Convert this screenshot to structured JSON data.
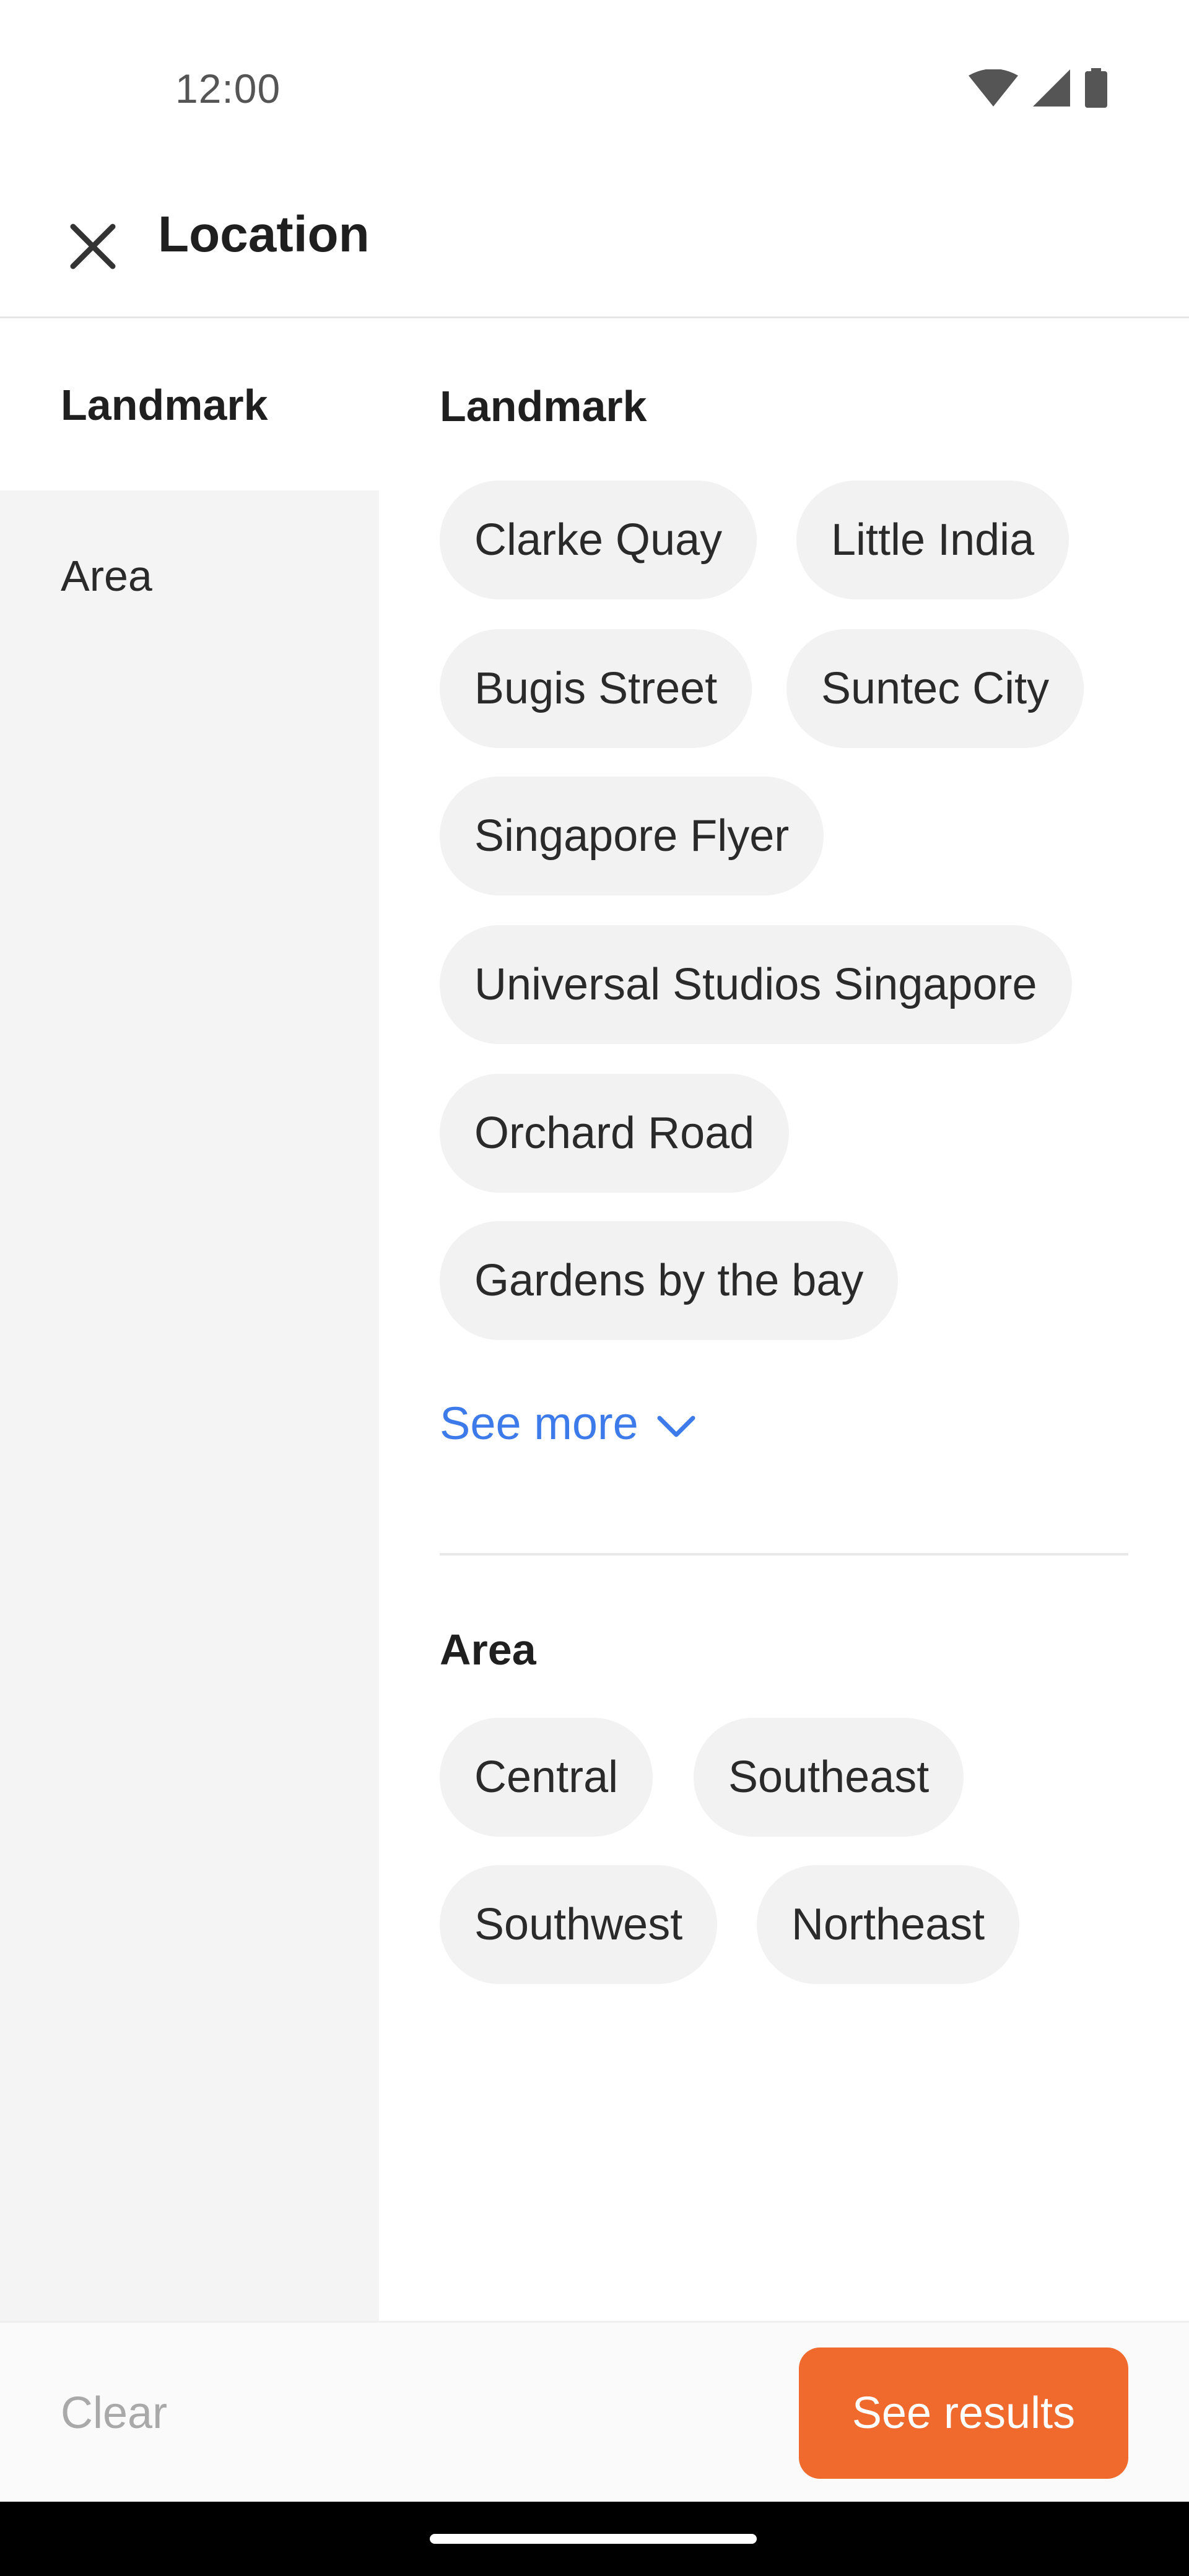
{
  "status_bar": {
    "time": "12:00",
    "icons": [
      "wifi-icon",
      "cellular-signal-icon",
      "battery-icon"
    ]
  },
  "header": {
    "close_icon": "close-icon",
    "title": "Location"
  },
  "left_nav": {
    "items": [
      {
        "label": "Landmark",
        "active": true
      },
      {
        "label": "Area",
        "active": false
      }
    ]
  },
  "landmark_section": {
    "title": "Landmark",
    "chips": [
      "Clarke Quay",
      "Little India",
      "Bugis Street",
      "Suntec City",
      "Singapore Flyer",
      "Universal Studios Singapore",
      "Orchard Road",
      "Gardens by the bay"
    ],
    "see_more_label": "See more",
    "see_more_icon": "chevron-down-icon"
  },
  "area_section": {
    "title": "Area",
    "chips": [
      "Central",
      "Southeast",
      "Southwest",
      "Northeast"
    ]
  },
  "actions": {
    "clear_label": "Clear",
    "see_results_label": "See results"
  },
  "colors": {
    "accent": "#f06a2e",
    "link": "#3d7bea",
    "chip_bg": "#f2f2f2",
    "nav_bg": "#f4f4f4"
  }
}
